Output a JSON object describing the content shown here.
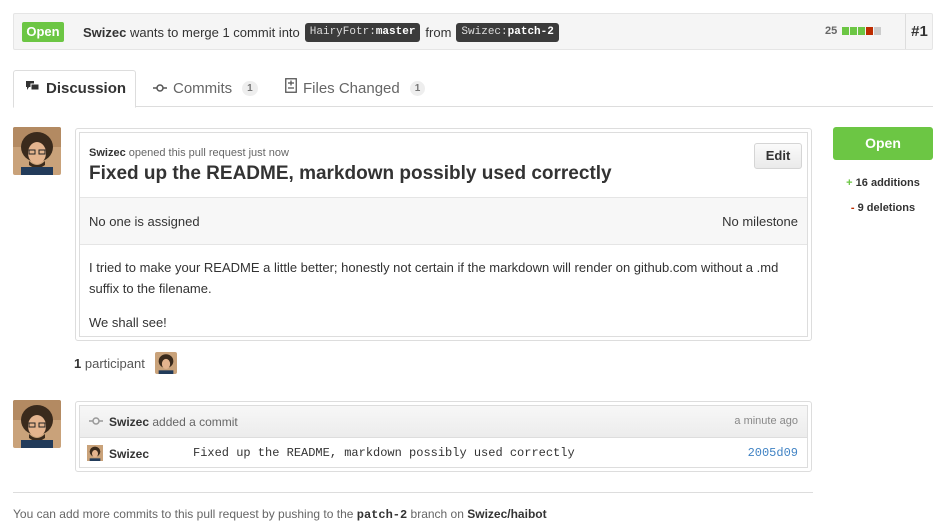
{
  "header": {
    "state": "Open",
    "author": "Swizec",
    "action_text": "wants to merge 1 commit into",
    "base_repo": "HairyFotr",
    "base_branch": "master",
    "from_text": "from",
    "head_repo": "Swizec",
    "head_branch": "patch-2",
    "diffstat_count": "25",
    "number": "#1",
    "colors": {
      "open_green": "#6cc644",
      "deletion_red": "#bd2c00",
      "neutral_gray": "#cccccc"
    }
  },
  "tabs": [
    {
      "label": "Discussion",
      "icon": "comment-discussion-icon"
    },
    {
      "label": "Commits",
      "count": "1",
      "icon": "git-commit-icon"
    },
    {
      "label": "Files Changed",
      "count": "1",
      "icon": "diff-file-icon"
    }
  ],
  "discussion": {
    "author": "Swizec",
    "opened_text": "opened this pull request just now",
    "title": "Fixed up the README, markdown possibly used correctly",
    "edit_label": "Edit",
    "assignee": "No one is assigned",
    "milestone": "No milestone",
    "body": [
      "I tried to make your README a little better; honestly not certain if the markdown will render on github.com without a .md suffix to the filename.",
      "We shall see!"
    ]
  },
  "participants": {
    "count": "1",
    "label": "participant"
  },
  "commit_event": {
    "author": "Swizec",
    "action": "added a commit",
    "time": "a minute ago",
    "commit_author": "Swizec",
    "message": "Fixed up the README, markdown possibly used correctly",
    "sha": "2005d09"
  },
  "footer": {
    "text_before": "You can add more commits to this pull request by pushing to the",
    "branch": "patch-2",
    "text_middle": "branch on",
    "repo": "Swizec/haibot"
  },
  "sidebar": {
    "state_button": "Open",
    "additions": "16 additions",
    "deletions": "9 deletions"
  }
}
